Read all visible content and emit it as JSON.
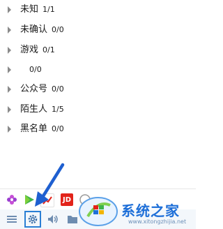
{
  "groups": [
    {
      "name": "未知",
      "count": "1/1"
    },
    {
      "name": "未确认",
      "count": "0/0"
    },
    {
      "name": "游戏",
      "count": "0/1"
    },
    {
      "name": "",
      "count": "0/0"
    },
    {
      "name": "公众号",
      "count": "0/0"
    },
    {
      "name": "陌生人",
      "count": "1/5"
    },
    {
      "name": "黑名单",
      "count": "0/0"
    }
  ],
  "apps": {
    "jd_label": "JD"
  },
  "watermark": {
    "title": "系统之家",
    "url": "www.xitongzhijia.net"
  },
  "colors": {
    "arrow_annotation": "#1e5fd0",
    "settings_highlight": "#2a7fd4",
    "jd_red": "#e2231a",
    "watermark_blue": "#1e6fd8"
  },
  "icons": [
    "flower-icon",
    "play-icon",
    "jd-icon",
    "chart-icon",
    "menu-icon",
    "gear-icon",
    "speaker-icon",
    "folder-icon"
  ]
}
